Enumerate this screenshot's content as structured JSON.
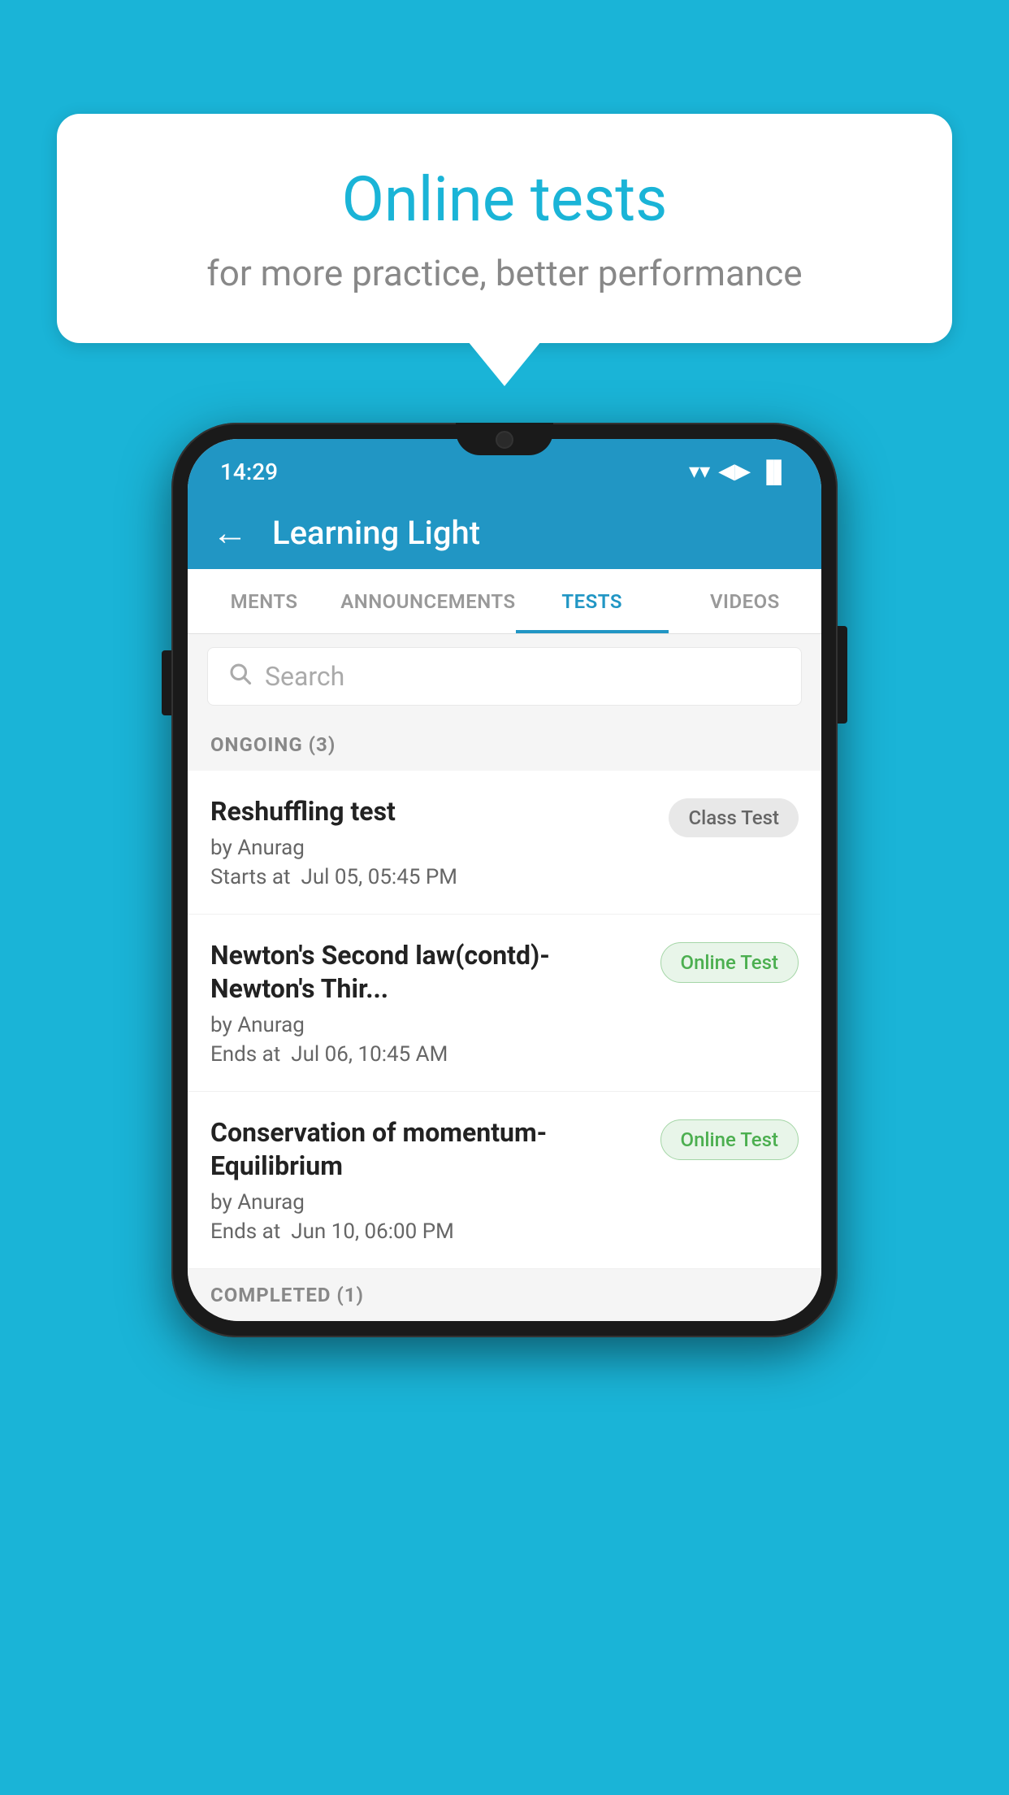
{
  "background": {
    "color": "#1ab4d7"
  },
  "speech_bubble": {
    "title": "Online tests",
    "subtitle": "for more practice, better performance"
  },
  "phone": {
    "status_bar": {
      "time": "14:29",
      "wifi": "▼",
      "signal": "▲",
      "battery": "▐"
    },
    "app_bar": {
      "back_icon": "←",
      "title": "Learning Light"
    },
    "tabs": [
      {
        "label": "MENTS",
        "active": false
      },
      {
        "label": "ANNOUNCEMENTS",
        "active": false
      },
      {
        "label": "TESTS",
        "active": true
      },
      {
        "label": "VIDEOS",
        "active": false
      }
    ],
    "search": {
      "placeholder": "Search",
      "icon": "🔍"
    },
    "ongoing_section": {
      "label": "ONGOING (3)"
    },
    "test_items": [
      {
        "name": "Reshuffling test",
        "author": "by Anurag",
        "date_label": "Starts at",
        "date": "Jul 05, 05:45 PM",
        "badge": "Class Test",
        "badge_type": "class"
      },
      {
        "name": "Newton's Second law(contd)-Newton's Thir...",
        "author": "by Anurag",
        "date_label": "Ends at",
        "date": "Jul 06, 10:45 AM",
        "badge": "Online Test",
        "badge_type": "online"
      },
      {
        "name": "Conservation of momentum-Equilibrium",
        "author": "by Anurag",
        "date_label": "Ends at",
        "date": "Jun 10, 06:00 PM",
        "badge": "Online Test",
        "badge_type": "online"
      }
    ],
    "completed_section": {
      "label": "COMPLETED (1)"
    }
  }
}
